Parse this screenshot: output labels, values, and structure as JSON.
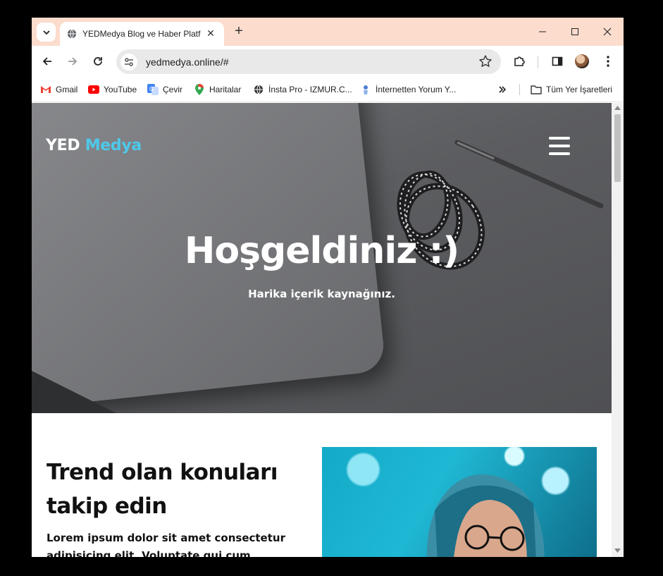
{
  "browser": {
    "tab_title": "YEDMedya Blog ve Haber Platformu",
    "url": "yedmedya.online/#",
    "bookmarks": [
      {
        "label": "Gmail",
        "icon": "gmail-icon"
      },
      {
        "label": "YouTube",
        "icon": "youtube-icon"
      },
      {
        "label": "Çevir",
        "icon": "translate-icon"
      },
      {
        "label": "Haritalar",
        "icon": "maps-icon"
      },
      {
        "label": "İnsta Pro - IZMUR.C...",
        "icon": "globe-icon"
      },
      {
        "label": "İnternetten Yorum Y...",
        "icon": "site-icon"
      }
    ],
    "all_bookmarks": "Tüm Yer İşaretleri"
  },
  "site": {
    "logo_part1": "YED",
    "logo_part2": "Medya",
    "accent_color": "#4fc8ea",
    "hero_title": "Hoşgeldiniz :)",
    "hero_subtitle": "Harika içerik kaynağınız.",
    "trend_title": "Trend olan konuları takip edin",
    "trend_body": "Lorem ipsum dolor sit amet consectetur adipisicing elit. Voluptate qui cum"
  }
}
